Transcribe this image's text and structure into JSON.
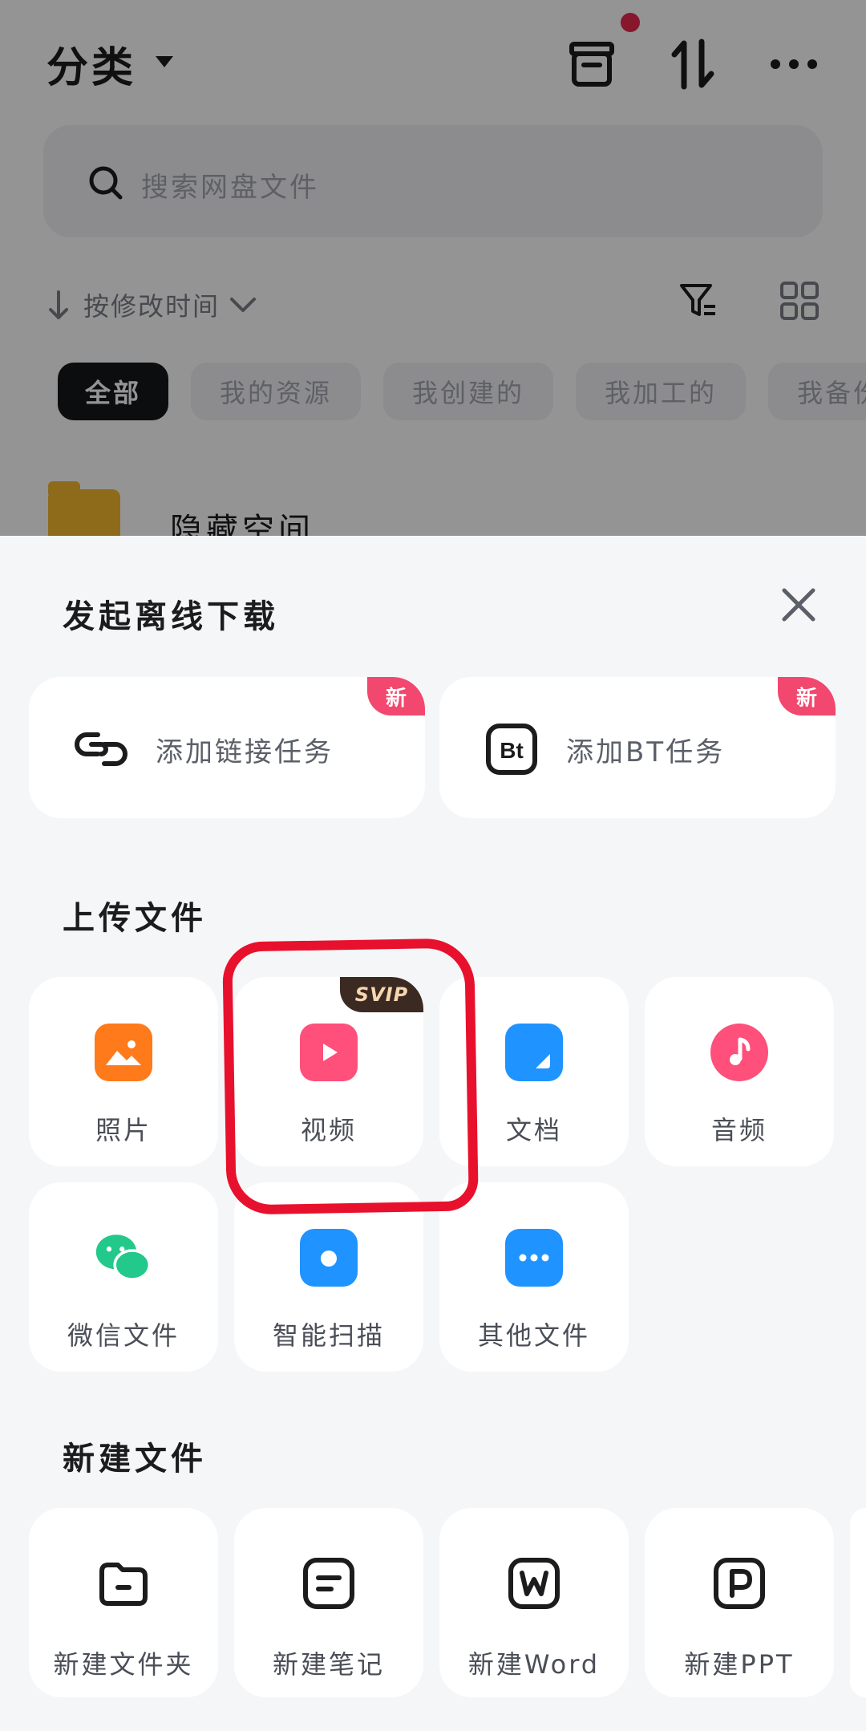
{
  "header": {
    "title": "分类",
    "icons": [
      "trash-bin-icon",
      "sort-icon",
      "more-icon"
    ],
    "has_notification": true
  },
  "search": {
    "placeholder": "搜索网盘文件"
  },
  "sort": {
    "label": "按修改时间"
  },
  "filter_chips": [
    {
      "label": "全部",
      "active": true
    },
    {
      "label": "我的资源"
    },
    {
      "label": "我创建的"
    },
    {
      "label": "我加工的"
    },
    {
      "label": "我备份"
    }
  ],
  "folder": {
    "name": "隐藏空间"
  },
  "sheet": {
    "title": "发起离线下载",
    "tasks": [
      {
        "label": "添加链接任务",
        "badge": "新",
        "icon": "link-icon"
      },
      {
        "label": "添加BT任务",
        "badge": "新",
        "icon": "bt-icon"
      }
    ],
    "upload_title": "上传文件",
    "upload": [
      {
        "label": "照片",
        "icon": "photo-icon",
        "color": "#ff7a1a"
      },
      {
        "label": "视频",
        "icon": "video-icon",
        "color": "#ff4f7b",
        "badge": "SVIP"
      },
      {
        "label": "文档",
        "icon": "document-icon",
        "color": "#1f93ff"
      },
      {
        "label": "音频",
        "icon": "audio-icon",
        "color": "#ff4f7b"
      },
      {
        "label": "微信文件",
        "icon": "wechat-icon",
        "color": "#22c98a"
      },
      {
        "label": "智能扫描",
        "icon": "camera-icon",
        "color": "#1f93ff"
      },
      {
        "label": "其他文件",
        "icon": "more-files-icon",
        "color": "#1f93ff"
      }
    ],
    "create_title": "新建文件",
    "create": [
      {
        "label": "新建文件夹",
        "icon": "new-folder-icon"
      },
      {
        "label": "新建笔记",
        "icon": "new-note-icon"
      },
      {
        "label": "新建Word",
        "icon": "word-icon"
      },
      {
        "label": "新建PPT",
        "icon": "ppt-icon"
      }
    ]
  }
}
